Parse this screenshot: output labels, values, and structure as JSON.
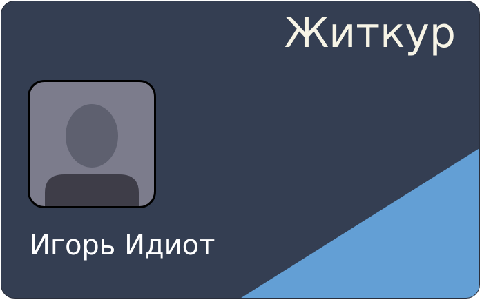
{
  "card": {
    "brand": "Житкур",
    "holder_name": "Игорь Идиот",
    "avatar_icon": "person-silhouette-icon",
    "colors": {
      "background": "#343e52",
      "accent": "#639fd5",
      "text": "#ffffff",
      "brand_text": "#f7f4e6",
      "photo_bg": "#7c7c8c"
    }
  }
}
